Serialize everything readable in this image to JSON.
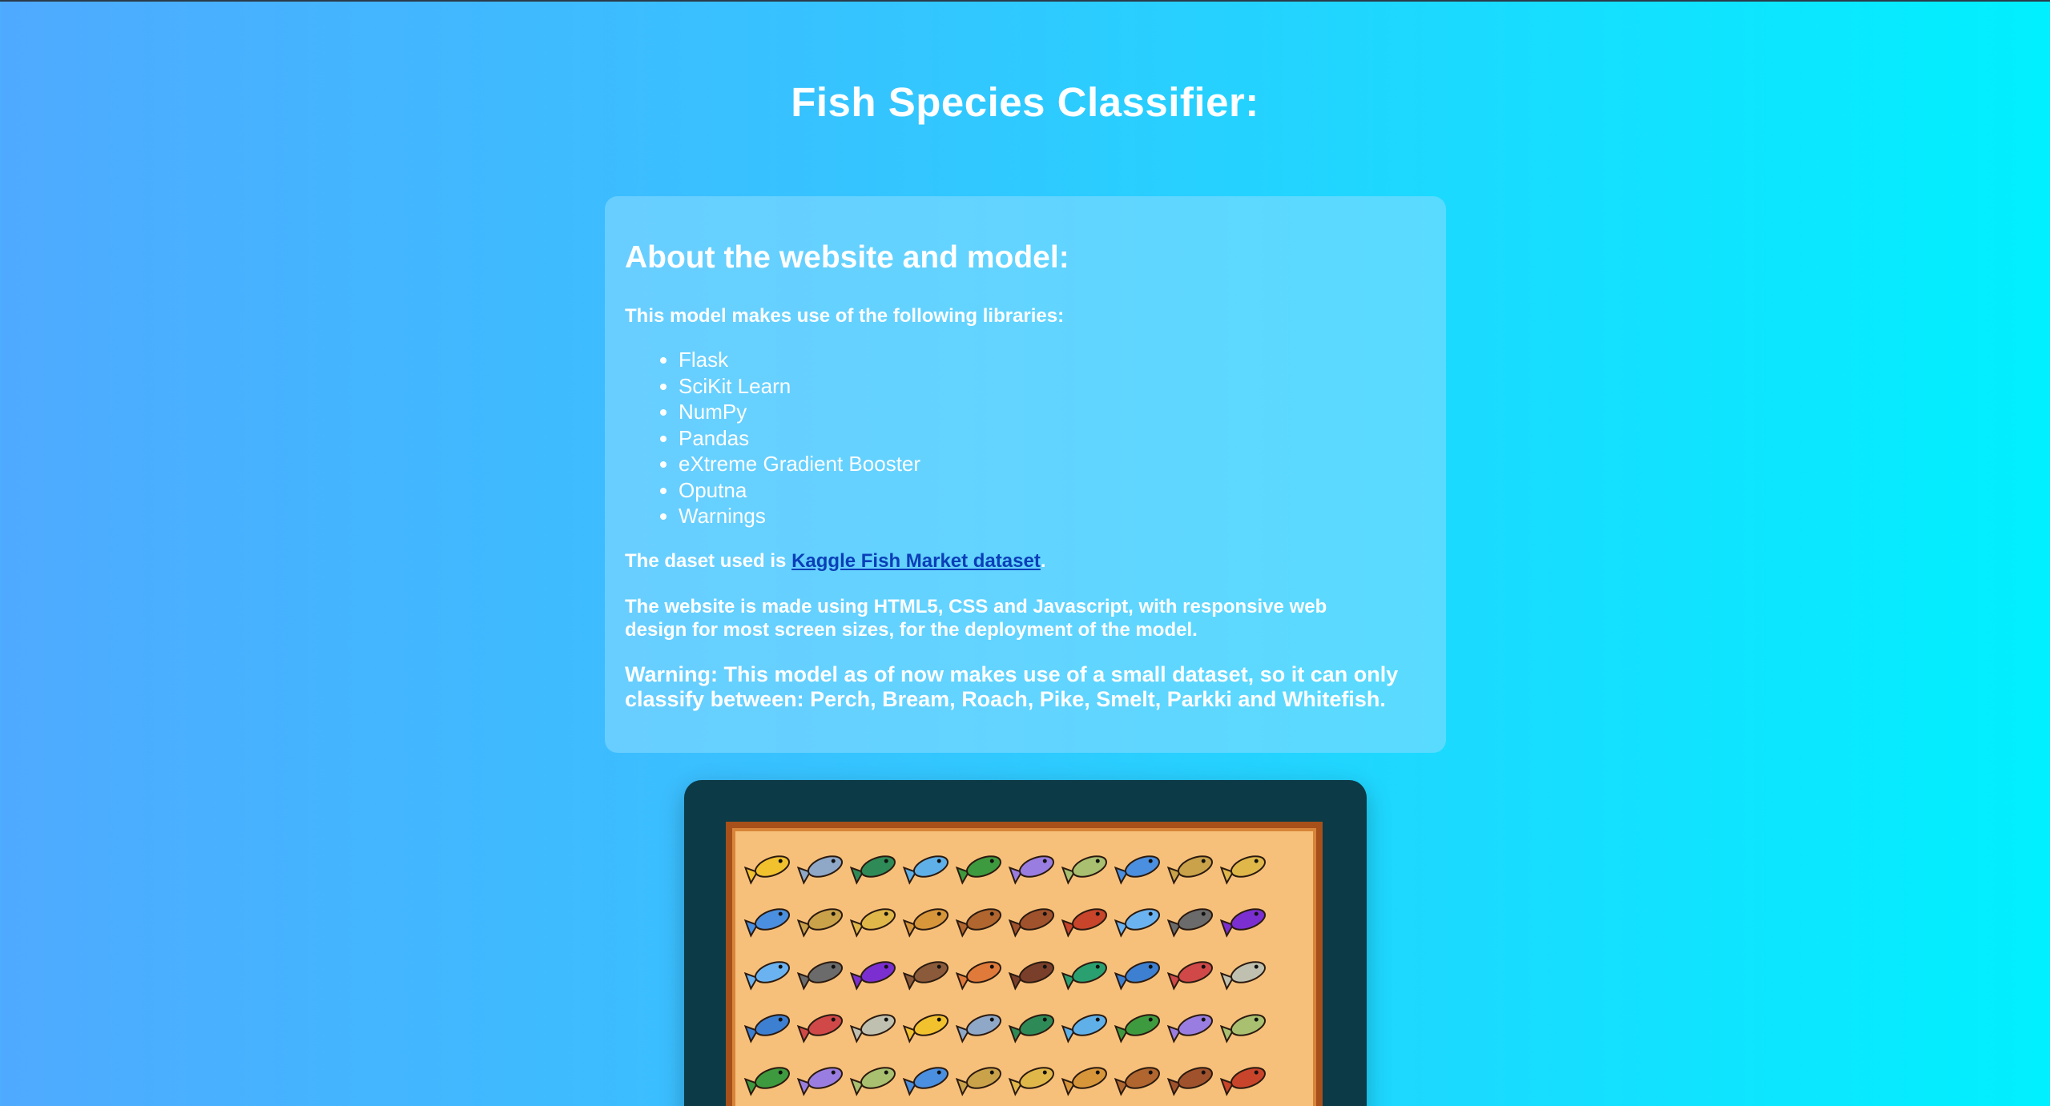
{
  "header": {
    "title": "Fish Species Classifier:"
  },
  "about": {
    "heading": "About the website and model:",
    "libraries_intro": "This model makes use of the following libraries:",
    "libraries": [
      "Flask",
      "SciKit Learn",
      "NumPy",
      "Pandas",
      "eXtreme Gradient Booster",
      "Oputna",
      "Warnings"
    ],
    "dataset_prefix": "The daset used is ",
    "dataset_link": "Kaggle Fish Market dataset",
    "dataset_suffix": ".",
    "website_text": "The website is made using HTML5, CSS and Javascript, with responsive web design for most screen sizes, for the deployment of the model.",
    "warning_text": "Warning: This model as of now makes use of a small dataset, so it can only classify between: Perch, Bream, Roach, Pike, Smelt, Parkki and Whitefish."
  },
  "colors": {
    "gradient_left": "#4faaff",
    "gradient_right": "#00f0ff",
    "link": "#0a3fb8",
    "frame": "#0c3a47",
    "art_border": "#a8501a",
    "art_background": "#f7c07a"
  }
}
